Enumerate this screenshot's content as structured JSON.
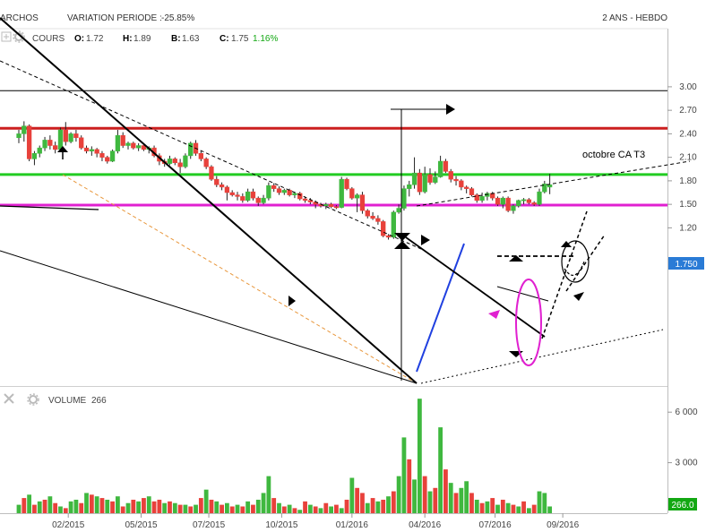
{
  "header": {
    "instrument": "ARCHOS",
    "variation_label": "VARIATION PERIODE :",
    "variation_value": "-25.85%",
    "period": "2 ANS - HEBDO"
  },
  "price_panel": {
    "name": "COURS",
    "o_label": "O:",
    "o_value": "1.72",
    "h_label": "H:",
    "h_value": "1.89",
    "b_label": "B:",
    "b_value": "1.63",
    "c_label": "C:",
    "c_value": "1.75",
    "change": "1.16%",
    "last_price": "1.750",
    "annotation": "octobre CA T3"
  },
  "volume_panel": {
    "name": "VOLUME",
    "value": "266",
    "last_value": "266.0"
  },
  "colors": {
    "up": "#3fb83f",
    "down": "#e8413b",
    "resistance": "#cc1f1f",
    "support_green": "#22cc22",
    "support_magenta": "#e020d0",
    "trend_blue": "#2040e0",
    "last_badge": "#2a7bd6",
    "volume_badge": "#13a813"
  },
  "chart_data": {
    "type": "candlestick",
    "price_axis": {
      "ticks": [
        "3.00",
        "2.70",
        "2.40",
        "2.10",
        "1.80",
        "1.50",
        "1.20"
      ],
      "values": [
        3.0,
        2.7,
        2.4,
        2.1,
        1.8,
        1.5,
        1.2
      ],
      "range": [
        1.04,
        3.08
      ]
    },
    "volume_axis": {
      "ticks": [
        "6 000",
        "3 000"
      ],
      "values": [
        6000,
        3000
      ],
      "range": [
        0,
        6800
      ]
    },
    "x_axis": {
      "labels": [
        "02/2015",
        "05/2015",
        "07/2015",
        "10/2015",
        "01/2016",
        "04/2016",
        "07/2016",
        "09/2016"
      ],
      "label_index": [
        9.5,
        23.5,
        36.5,
        50.5,
        64,
        78,
        91.5,
        104.5
      ]
    },
    "horizontal_lines": [
      {
        "name": "top-line",
        "value": 2.95,
        "color": "#000000"
      },
      {
        "name": "resistance-line",
        "value": 2.47,
        "color": "#cc1f1f"
      },
      {
        "name": "green-support-line",
        "value": 1.88,
        "color": "#22cc22"
      },
      {
        "name": "magenta-support-line",
        "value": 1.49,
        "color": "#e020d0"
      }
    ],
    "candles": [
      {
        "o": 2.35,
        "h": 2.45,
        "l": 2.28,
        "c": 2.4
      },
      {
        "o": 2.4,
        "h": 2.56,
        "l": 2.3,
        "c": 2.5
      },
      {
        "o": 2.5,
        "h": 2.52,
        "l": 2.05,
        "c": 2.08
      },
      {
        "o": 2.08,
        "h": 2.18,
        "l": 2.0,
        "c": 2.15
      },
      {
        "o": 2.15,
        "h": 2.25,
        "l": 2.1,
        "c": 2.22
      },
      {
        "o": 2.22,
        "h": 2.36,
        "l": 2.18,
        "c": 2.32
      },
      {
        "o": 2.32,
        "h": 2.38,
        "l": 2.2,
        "c": 2.25
      },
      {
        "o": 2.25,
        "h": 2.3,
        "l": 2.15,
        "c": 2.2
      },
      {
        "o": 2.2,
        "h": 2.48,
        "l": 2.18,
        "c": 2.45
      },
      {
        "o": 2.45,
        "h": 2.55,
        "l": 2.25,
        "c": 2.3
      },
      {
        "o": 2.3,
        "h": 2.42,
        "l": 2.28,
        "c": 2.4
      },
      {
        "o": 2.4,
        "h": 2.45,
        "l": 2.3,
        "c": 2.35
      },
      {
        "o": 2.35,
        "h": 2.38,
        "l": 2.2,
        "c": 2.22
      },
      {
        "o": 2.22,
        "h": 2.25,
        "l": 2.15,
        "c": 2.18
      },
      {
        "o": 2.18,
        "h": 2.24,
        "l": 2.12,
        "c": 2.2
      },
      {
        "o": 2.2,
        "h": 2.22,
        "l": 2.1,
        "c": 2.15
      },
      {
        "o": 2.15,
        "h": 2.18,
        "l": 2.05,
        "c": 2.1
      },
      {
        "o": 2.1,
        "h": 2.12,
        "l": 2.02,
        "c": 2.05
      },
      {
        "o": 2.05,
        "h": 2.2,
        "l": 2.04,
        "c": 2.18
      },
      {
        "o": 2.18,
        "h": 2.45,
        "l": 2.15,
        "c": 2.38
      },
      {
        "o": 2.38,
        "h": 2.42,
        "l": 2.22,
        "c": 2.25
      },
      {
        "o": 2.25,
        "h": 2.3,
        "l": 2.2,
        "c": 2.28
      },
      {
        "o": 2.28,
        "h": 2.3,
        "l": 2.2,
        "c": 2.22
      },
      {
        "o": 2.22,
        "h": 2.28,
        "l": 2.18,
        "c": 2.25
      },
      {
        "o": 2.25,
        "h": 2.27,
        "l": 2.18,
        "c": 2.2
      },
      {
        "o": 2.2,
        "h": 2.24,
        "l": 2.15,
        "c": 2.22
      },
      {
        "o": 2.22,
        "h": 2.25,
        "l": 2.1,
        "c": 2.12
      },
      {
        "o": 2.12,
        "h": 2.15,
        "l": 2.0,
        "c": 2.05
      },
      {
        "o": 2.05,
        "h": 2.08,
        "l": 1.98,
        "c": 2.02
      },
      {
        "o": 2.02,
        "h": 2.12,
        "l": 2.0,
        "c": 2.08
      },
      {
        "o": 2.08,
        "h": 2.1,
        "l": 2.0,
        "c": 2.03
      },
      {
        "o": 2.03,
        "h": 2.08,
        "l": 1.9,
        "c": 1.98
      },
      {
        "o": 1.98,
        "h": 2.15,
        "l": 1.96,
        "c": 2.12
      },
      {
        "o": 2.12,
        "h": 2.3,
        "l": 2.08,
        "c": 2.28
      },
      {
        "o": 2.28,
        "h": 2.32,
        "l": 2.12,
        "c": 2.15
      },
      {
        "o": 2.15,
        "h": 2.18,
        "l": 2.05,
        "c": 2.08
      },
      {
        "o": 2.08,
        "h": 2.1,
        "l": 1.95,
        "c": 1.98
      },
      {
        "o": 1.98,
        "h": 2.0,
        "l": 1.8,
        "c": 1.82
      },
      {
        "o": 1.82,
        "h": 1.86,
        "l": 1.72,
        "c": 1.75
      },
      {
        "o": 1.75,
        "h": 1.78,
        "l": 1.68,
        "c": 1.72
      },
      {
        "o": 1.72,
        "h": 1.74,
        "l": 1.55,
        "c": 1.65
      },
      {
        "o": 1.65,
        "h": 1.68,
        "l": 1.6,
        "c": 1.62
      },
      {
        "o": 1.62,
        "h": 1.66,
        "l": 1.55,
        "c": 1.6
      },
      {
        "o": 1.6,
        "h": 1.64,
        "l": 1.52,
        "c": 1.55
      },
      {
        "o": 1.55,
        "h": 1.7,
        "l": 1.53,
        "c": 1.66
      },
      {
        "o": 1.66,
        "h": 1.7,
        "l": 1.55,
        "c": 1.58
      },
      {
        "o": 1.58,
        "h": 1.6,
        "l": 1.48,
        "c": 1.52
      },
      {
        "o": 1.52,
        "h": 1.62,
        "l": 1.5,
        "c": 1.58
      },
      {
        "o": 1.58,
        "h": 1.78,
        "l": 1.55,
        "c": 1.74
      },
      {
        "o": 1.74,
        "h": 1.77,
        "l": 1.66,
        "c": 1.7
      },
      {
        "o": 1.7,
        "h": 1.73,
        "l": 1.62,
        "c": 1.65
      },
      {
        "o": 1.65,
        "h": 1.7,
        "l": 1.62,
        "c": 1.68
      },
      {
        "o": 1.68,
        "h": 1.7,
        "l": 1.6,
        "c": 1.62
      },
      {
        "o": 1.62,
        "h": 1.66,
        "l": 1.58,
        "c": 1.64
      },
      {
        "o": 1.64,
        "h": 1.66,
        "l": 1.55,
        "c": 1.57
      },
      {
        "o": 1.57,
        "h": 1.6,
        "l": 1.52,
        "c": 1.55
      },
      {
        "o": 1.55,
        "h": 1.58,
        "l": 1.5,
        "c": 1.53
      },
      {
        "o": 1.53,
        "h": 1.55,
        "l": 1.45,
        "c": 1.5
      },
      {
        "o": 1.5,
        "h": 1.52,
        "l": 1.46,
        "c": 1.48
      },
      {
        "o": 1.48,
        "h": 1.52,
        "l": 1.44,
        "c": 1.5
      },
      {
        "o": 1.5,
        "h": 1.52,
        "l": 1.45,
        "c": 1.47
      },
      {
        "o": 1.47,
        "h": 1.49,
        "l": 1.44,
        "c": 1.46
      },
      {
        "o": 1.46,
        "h": 1.85,
        "l": 1.45,
        "c": 1.82
      },
      {
        "o": 1.82,
        "h": 1.84,
        "l": 1.68,
        "c": 1.7
      },
      {
        "o": 1.7,
        "h": 1.72,
        "l": 1.56,
        "c": 1.58
      },
      {
        "o": 1.58,
        "h": 1.64,
        "l": 1.4,
        "c": 1.62
      },
      {
        "o": 1.62,
        "h": 1.66,
        "l": 1.38,
        "c": 1.42
      },
      {
        "o": 1.42,
        "h": 1.44,
        "l": 1.32,
        "c": 1.35
      },
      {
        "o": 1.35,
        "h": 1.4,
        "l": 1.3,
        "c": 1.32
      },
      {
        "o": 1.32,
        "h": 1.36,
        "l": 1.24,
        "c": 1.28
      },
      {
        "o": 1.28,
        "h": 1.3,
        "l": 1.08,
        "c": 1.1
      },
      {
        "o": 1.1,
        "h": 1.12,
        "l": 1.05,
        "c": 1.08
      },
      {
        "o": 1.08,
        "h": 1.42,
        "l": 1.06,
        "c": 1.4
      },
      {
        "o": 1.4,
        "h": 1.5,
        "l": 1.38,
        "c": 1.45
      },
      {
        "o": 1.45,
        "h": 1.74,
        "l": 1.42,
        "c": 1.7
      },
      {
        "o": 1.7,
        "h": 1.8,
        "l": 1.6,
        "c": 1.75
      },
      {
        "o": 1.75,
        "h": 2.1,
        "l": 1.7,
        "c": 1.9
      },
      {
        "o": 1.9,
        "h": 1.95,
        "l": 1.62,
        "c": 1.66
      },
      {
        "o": 1.66,
        "h": 1.98,
        "l": 1.64,
        "c": 1.88
      },
      {
        "o": 1.88,
        "h": 1.96,
        "l": 1.75,
        "c": 1.78
      },
      {
        "o": 1.78,
        "h": 1.92,
        "l": 1.76,
        "c": 1.85
      },
      {
        "o": 1.85,
        "h": 2.12,
        "l": 1.84,
        "c": 2.05
      },
      {
        "o": 2.05,
        "h": 2.08,
        "l": 1.9,
        "c": 1.92
      },
      {
        "o": 1.92,
        "h": 1.95,
        "l": 1.78,
        "c": 1.82
      },
      {
        "o": 1.82,
        "h": 1.86,
        "l": 1.74,
        "c": 1.8
      },
      {
        "o": 1.8,
        "h": 1.82,
        "l": 1.68,
        "c": 1.72
      },
      {
        "o": 1.72,
        "h": 1.74,
        "l": 1.64,
        "c": 1.7
      },
      {
        "o": 1.7,
        "h": 1.72,
        "l": 1.6,
        "c": 1.62
      },
      {
        "o": 1.62,
        "h": 1.64,
        "l": 1.52,
        "c": 1.55
      },
      {
        "o": 1.55,
        "h": 1.65,
        "l": 1.52,
        "c": 1.6
      },
      {
        "o": 1.6,
        "h": 1.66,
        "l": 1.55,
        "c": 1.64
      },
      {
        "o": 1.64,
        "h": 1.66,
        "l": 1.55,
        "c": 1.58
      },
      {
        "o": 1.58,
        "h": 1.6,
        "l": 1.48,
        "c": 1.5
      },
      {
        "o": 1.5,
        "h": 1.6,
        "l": 1.45,
        "c": 1.58
      },
      {
        "o": 1.58,
        "h": 1.6,
        "l": 1.4,
        "c": 1.42
      },
      {
        "o": 1.42,
        "h": 1.5,
        "l": 1.38,
        "c": 1.48
      },
      {
        "o": 1.48,
        "h": 1.56,
        "l": 1.46,
        "c": 1.55
      },
      {
        "o": 1.55,
        "h": 1.58,
        "l": 1.5,
        "c": 1.56
      },
      {
        "o": 1.56,
        "h": 1.58,
        "l": 1.5,
        "c": 1.52
      },
      {
        "o": 1.52,
        "h": 1.54,
        "l": 1.48,
        "c": 1.5
      },
      {
        "o": 1.5,
        "h": 1.7,
        "l": 1.48,
        "c": 1.66
      },
      {
        "o": 1.66,
        "h": 1.8,
        "l": 1.64,
        "c": 1.76
      },
      {
        "o": 1.72,
        "h": 1.89,
        "l": 1.63,
        "c": 1.75
      }
    ],
    "volumes": [
      {
        "v": 500,
        "up": true
      },
      {
        "v": 900,
        "up": false
      },
      {
        "v": 1100,
        "up": true
      },
      {
        "v": 500,
        "up": false
      },
      {
        "v": 700,
        "up": true
      },
      {
        "v": 800,
        "up": false
      },
      {
        "v": 1000,
        "up": true
      },
      {
        "v": 600,
        "up": false
      },
      {
        "v": 400,
        "up": true
      },
      {
        "v": 300,
        "up": false
      },
      {
        "v": 700,
        "up": true
      },
      {
        "v": 800,
        "up": true
      },
      {
        "v": 600,
        "up": false
      },
      {
        "v": 1200,
        "up": true
      },
      {
        "v": 1100,
        "up": false
      },
      {
        "v": 1000,
        "up": true
      },
      {
        "v": 900,
        "up": false
      },
      {
        "v": 800,
        "up": true
      },
      {
        "v": 700,
        "up": false
      },
      {
        "v": 1000,
        "up": true
      },
      {
        "v": 400,
        "up": false
      },
      {
        "v": 600,
        "up": true
      },
      {
        "v": 800,
        "up": false
      },
      {
        "v": 700,
        "up": true
      },
      {
        "v": 900,
        "up": false
      },
      {
        "v": 1000,
        "up": true
      },
      {
        "v": 700,
        "up": false
      },
      {
        "v": 800,
        "up": false
      },
      {
        "v": 600,
        "up": true
      },
      {
        "v": 700,
        "up": false
      },
      {
        "v": 600,
        "up": true
      },
      {
        "v": 500,
        "up": false
      },
      {
        "v": 500,
        "up": true
      },
      {
        "v": 400,
        "up": false
      },
      {
        "v": 500,
        "up": true
      },
      {
        "v": 900,
        "up": false
      },
      {
        "v": 1400,
        "up": true
      },
      {
        "v": 800,
        "up": false
      },
      {
        "v": 700,
        "up": true
      },
      {
        "v": 500,
        "up": false
      },
      {
        "v": 600,
        "up": true
      },
      {
        "v": 400,
        "up": false
      },
      {
        "v": 500,
        "up": true
      },
      {
        "v": 400,
        "up": false
      },
      {
        "v": 700,
        "up": true
      },
      {
        "v": 500,
        "up": false
      },
      {
        "v": 800,
        "up": true
      },
      {
        "v": 1200,
        "up": true
      },
      {
        "v": 2200,
        "up": true
      },
      {
        "v": 900,
        "up": false
      },
      {
        "v": 600,
        "up": true
      },
      {
        "v": 400,
        "up": false
      },
      {
        "v": 500,
        "up": true
      },
      {
        "v": 300,
        "up": false
      },
      {
        "v": 200,
        "up": true
      },
      {
        "v": 700,
        "up": false
      },
      {
        "v": 500,
        "up": true
      },
      {
        "v": 400,
        "up": false
      },
      {
        "v": 300,
        "up": true
      },
      {
        "v": 600,
        "up": false
      },
      {
        "v": 400,
        "up": true
      },
      {
        "v": 500,
        "up": false
      },
      {
        "v": 300,
        "up": true
      },
      {
        "v": 800,
        "up": false
      },
      {
        "v": 2100,
        "up": true
      },
      {
        "v": 1500,
        "up": false
      },
      {
        "v": 1200,
        "up": false
      },
      {
        "v": 600,
        "up": true
      },
      {
        "v": 900,
        "up": false
      },
      {
        "v": 700,
        "up": true
      },
      {
        "v": 800,
        "up": false
      },
      {
        "v": 1000,
        "up": true
      },
      {
        "v": 1300,
        "up": false
      },
      {
        "v": 2200,
        "up": true
      },
      {
        "v": 4500,
        "up": true
      },
      {
        "v": 3200,
        "up": false
      },
      {
        "v": 2000,
        "up": true
      },
      {
        "v": 6800,
        "up": true
      },
      {
        "v": 2200,
        "up": false
      },
      {
        "v": 1300,
        "up": true
      },
      {
        "v": 1500,
        "up": false
      },
      {
        "v": 5100,
        "up": true
      },
      {
        "v": 2600,
        "up": false
      },
      {
        "v": 1800,
        "up": true
      },
      {
        "v": 1200,
        "up": false
      },
      {
        "v": 1500,
        "up": true
      },
      {
        "v": 1900,
        "up": true
      },
      {
        "v": 1200,
        "up": false
      },
      {
        "v": 800,
        "up": true
      },
      {
        "v": 600,
        "up": false
      },
      {
        "v": 700,
        "up": true
      },
      {
        "v": 900,
        "up": false
      },
      {
        "v": 500,
        "up": true
      },
      {
        "v": 800,
        "up": false
      },
      {
        "v": 600,
        "up": true
      },
      {
        "v": 500,
        "up": false
      },
      {
        "v": 400,
        "up": true
      },
      {
        "v": 700,
        "up": false
      },
      {
        "v": 300,
        "up": true
      },
      {
        "v": 500,
        "up": false
      },
      {
        "v": 1300,
        "up": true
      },
      {
        "v": 1200,
        "up": true
      },
      {
        "v": 400,
        "up": true
      }
    ]
  }
}
